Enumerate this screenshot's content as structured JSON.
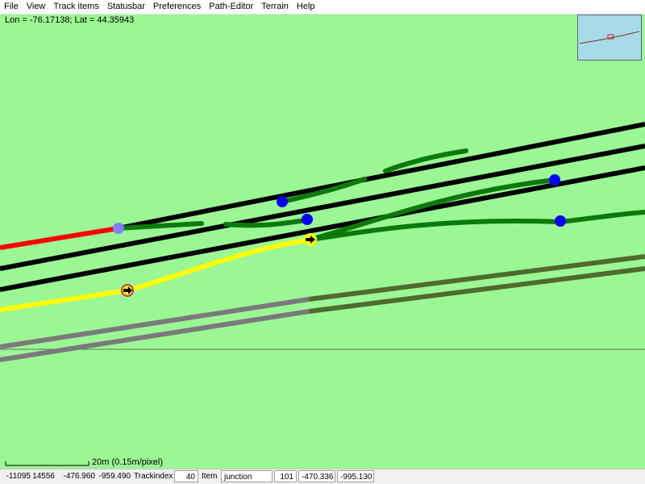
{
  "menu": [
    "File",
    "View",
    "Track items",
    "Statusbar",
    "Preferences",
    "Path-Editor",
    "Terrain",
    "Help"
  ],
  "coordinates": "Lon = -76.17138; Lat = 44.35943",
  "scale": {
    "label": "20m (0.15m/pixel)"
  },
  "status": {
    "x": "-11095",
    "z": "14556",
    "v1": "-476.960",
    "v2": "-959.490",
    "trackindex_label": "Trackindex",
    "trackindex_value": "40",
    "item_label": "Item",
    "item_value": "junction",
    "item_index": "101",
    "v3": "-470.336",
    "v4": "-995.130"
  },
  "colors": {
    "background": "#9bf694",
    "track": "#000000",
    "path": "#0b7a0b",
    "active_path": "#ffff00",
    "red_segment": "#ff0000",
    "junction": "#0000ff",
    "road_gray": "#808080",
    "road_green": "#4f6b2f"
  },
  "icons": [
    "start-marker-icon",
    "waypoint-arrow-icon",
    "junction-dot-icon"
  ]
}
